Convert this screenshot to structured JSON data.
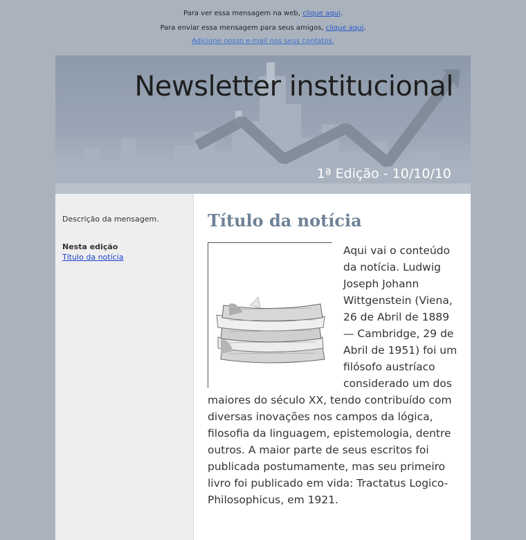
{
  "top": {
    "line1_prefix": "Para ver essa mensagem na web, ",
    "line1_link": "clique aqui",
    "line1_suffix": ".",
    "line2_prefix": "Para enviar essa mensagem para seus amigos, ",
    "line2_link": "clique aqui",
    "line2_suffix": ".",
    "line3_link": "Adicione nosso e-mail nos seus contatos."
  },
  "header": {
    "title": "Newsletter institucional",
    "edition": "1ª Edição - 10/10/10"
  },
  "sidebar": {
    "description": "Descrição da mensagem.",
    "edition_heading": "Nesta edição",
    "edition_link": "Título da notícia"
  },
  "article": {
    "title": "Título da notícia",
    "body": "Aqui vai o conteúdo da notícia. Ludwig Joseph Johann Wittgenstein (Viena, 26 de Abril de 1889 — Cambridge, 29 de Abril de 1951) foi um filósofo austríaco considerado um dos maiores do século XX, tendo contribuído com diversas inovações nos campos da lógica, filosofia da linguagem, epistemologia, dentre outros. A maior parte de seus escritos foi publicada postumamente, mas seu primeiro livro foi publicado em vida: Tractatus Logico-Philosophicus, em 1921.",
    "image_icon": "newspaper-stack-image"
  },
  "colors": {
    "page_background": "#aab3bd",
    "header_background": "#9aa6b5",
    "article_title": "#6e8296",
    "link": "#2a57c9"
  }
}
